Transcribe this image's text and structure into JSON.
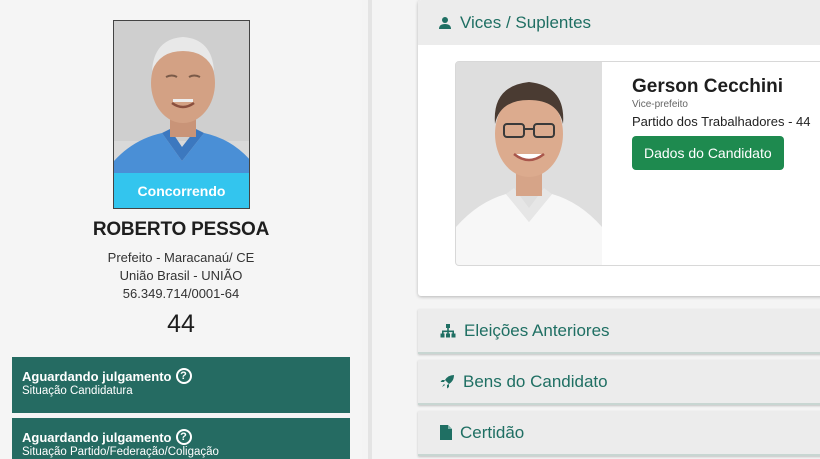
{
  "candidate": {
    "photo_badge": "Concorrendo",
    "name": "ROBERTO PESSOA",
    "office_location": "Prefeito - Maracanaú/ CE",
    "party": "União Brasil - UNIÃO",
    "cnpj": "56.349.714/0001-64",
    "number": "44"
  },
  "status_boxes": [
    {
      "title": "Aguardando julgamento",
      "subtitle": "Situação Candidatura"
    },
    {
      "title": "Aguardando julgamento",
      "subtitle": "Situação Partido/Federação/Coligação"
    }
  ],
  "vices_section": {
    "title": "Vices / Suplentes",
    "vice": {
      "name": "Gerson Cecchini",
      "role": "Vice-prefeito",
      "party": "Partido dos Trabalhadores - 44",
      "button_label": "Dados do Candidato"
    }
  },
  "accordions": [
    {
      "title": "Eleições Anteriores",
      "icon": "sitemap-icon"
    },
    {
      "title": "Bens do Candidato",
      "icon": "rocket-icon"
    },
    {
      "title": "Certidão",
      "icon": "file-icon"
    }
  ],
  "colors": {
    "status_bg": "#256b62",
    "badge_bg": "#33c5ee",
    "accent_text": "#1f6f63",
    "button_bg": "#1e8a4f"
  }
}
